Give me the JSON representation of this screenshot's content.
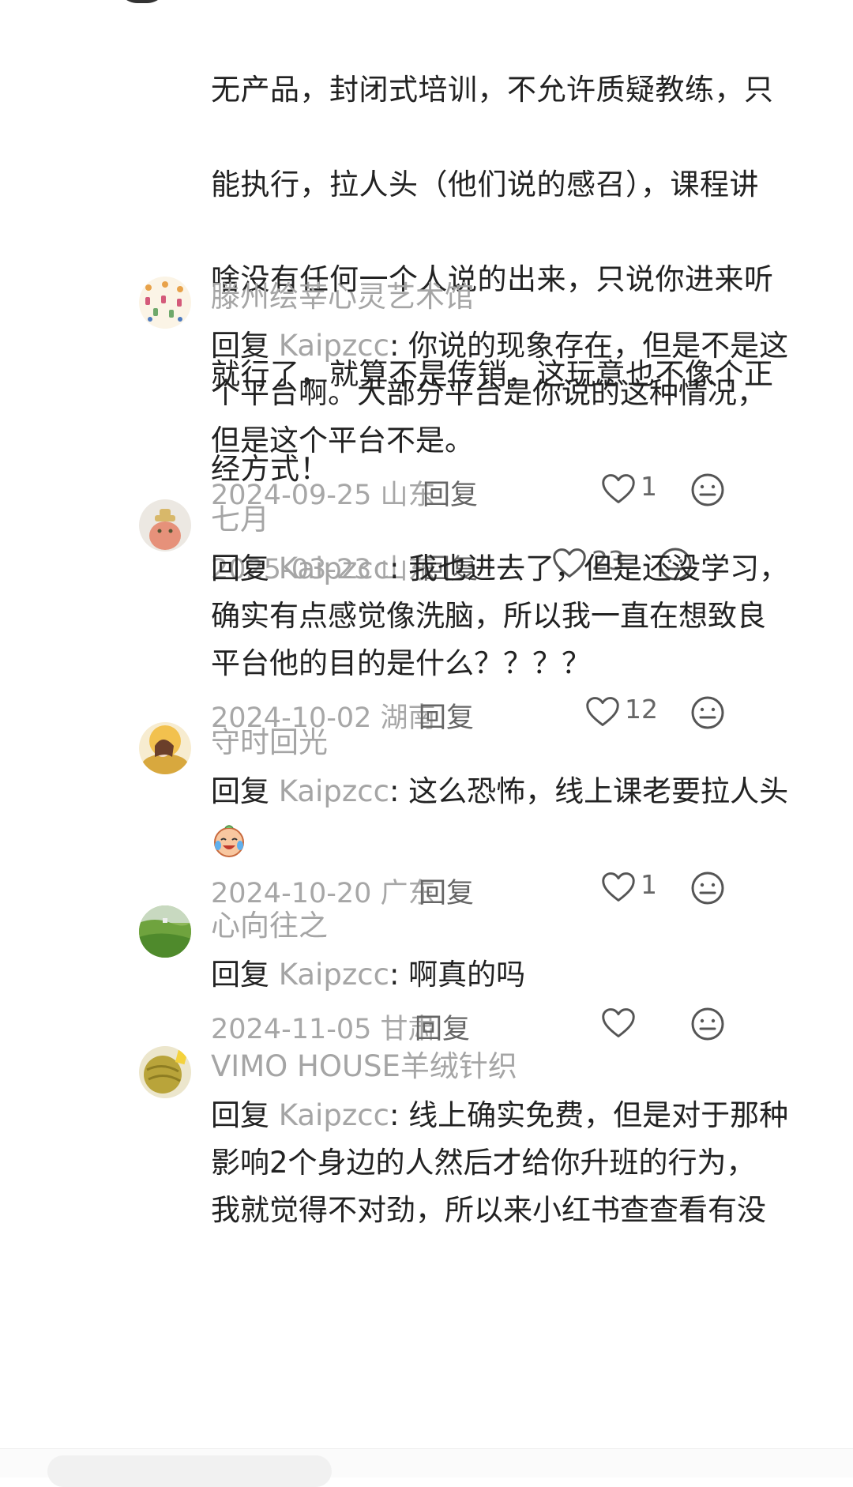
{
  "first_comment": {
    "text_lines": [
      "无产品，封闭式培训，不允许质疑教练，只",
      "能执行，拉人头（他们说的感召），课程讲",
      "啥没有任何一个人说的出来，只说你进来听",
      "就行了，就算不是传销，这玩意也不像个正",
      "经方式！"
    ],
    "date": "2025-03-23",
    "location": "山东",
    "reply_label": "回复",
    "likes": "23"
  },
  "replies": [
    {
      "name": "滕州绘莘心灵艺术馆",
      "prefix": "回复 ",
      "handle": "Kaipzcc",
      "text_lines": [
        "你说的现象存在，但是不是这",
        "个平台啊。大部分平台是你说的这种情况，",
        "但是这个平台不是。"
      ],
      "date": "2024-09-25",
      "location": "山东",
      "reply_label": "回复",
      "likes": "1"
    },
    {
      "name": "七月",
      "prefix": "回复 ",
      "handle": "Kaipzcc",
      "text_lines": [
        "我也进去了，但是还没学习，",
        "确实有点感觉像洗脑，所以我一直在想致良",
        "平台他的目的是什么？？？？"
      ],
      "date": "2024-10-02",
      "location": "湖南",
      "reply_label": "回复",
      "likes": "12"
    },
    {
      "name": "守时回光",
      "prefix": "回复 ",
      "handle": "Kaipzcc",
      "text_lines": [
        "这么恐怖，线上课老要拉人头"
      ],
      "date": "2024-10-20",
      "location": "广东",
      "reply_label": "回复",
      "likes": "1"
    },
    {
      "name": "心向往之",
      "prefix": "回复 ",
      "handle": "Kaipzcc",
      "text_lines": [
        "啊真的吗"
      ],
      "date": "2024-11-05",
      "location": "甘肃",
      "reply_label": "回复",
      "likes": ""
    },
    {
      "name": "VIMO HOUSE羊绒针织",
      "prefix": "回复 ",
      "handle": "Kaipzcc",
      "text_lines": [
        "线上确实免费，但是对于那种",
        "影响2个身边的人然后才给你升班的行为，",
        "我就觉得不对劲，所以来小红书查查看有没"
      ]
    }
  ],
  "icons": {
    "like": "heart-outline-icon",
    "emoji_react": "emoji-neutral-icon",
    "sticker": "crying-laughing-sticker-icon"
  },
  "colors": {
    "text": "#222222",
    "muted": "#a7a7a7",
    "reply_link": "#666666"
  }
}
